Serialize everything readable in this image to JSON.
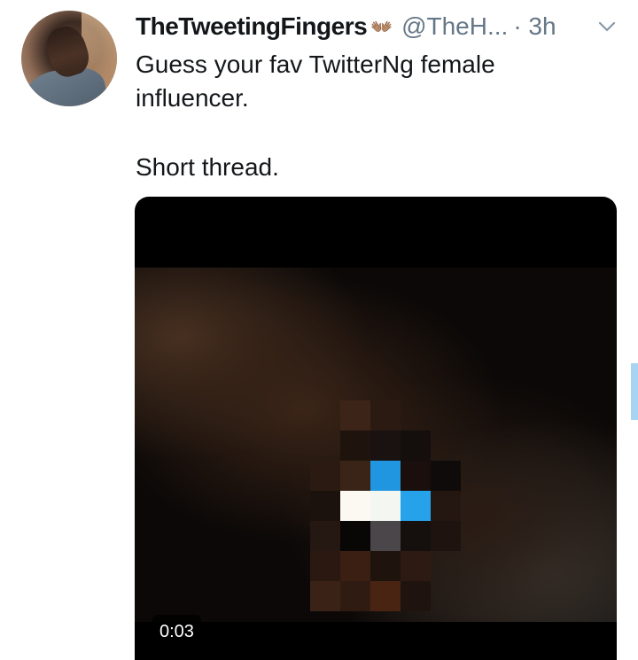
{
  "tweet": {
    "display_name": "TheTweetingFingers",
    "name_emoji": "👐🏽",
    "handle": "@TheH...",
    "time": "· 3h",
    "text_line1": "Guess your fav TwitterNg female",
    "text_line2": "influencer.",
    "text_line3": "Short thread.",
    "menu_icon": "chevron-down-icon"
  },
  "media": {
    "type": "video",
    "duration": "0:03"
  },
  "colors": {
    "text_primary": "#14171a",
    "text_secondary": "#657786",
    "accent": "#1da1f2",
    "media_bg": "#000000"
  }
}
